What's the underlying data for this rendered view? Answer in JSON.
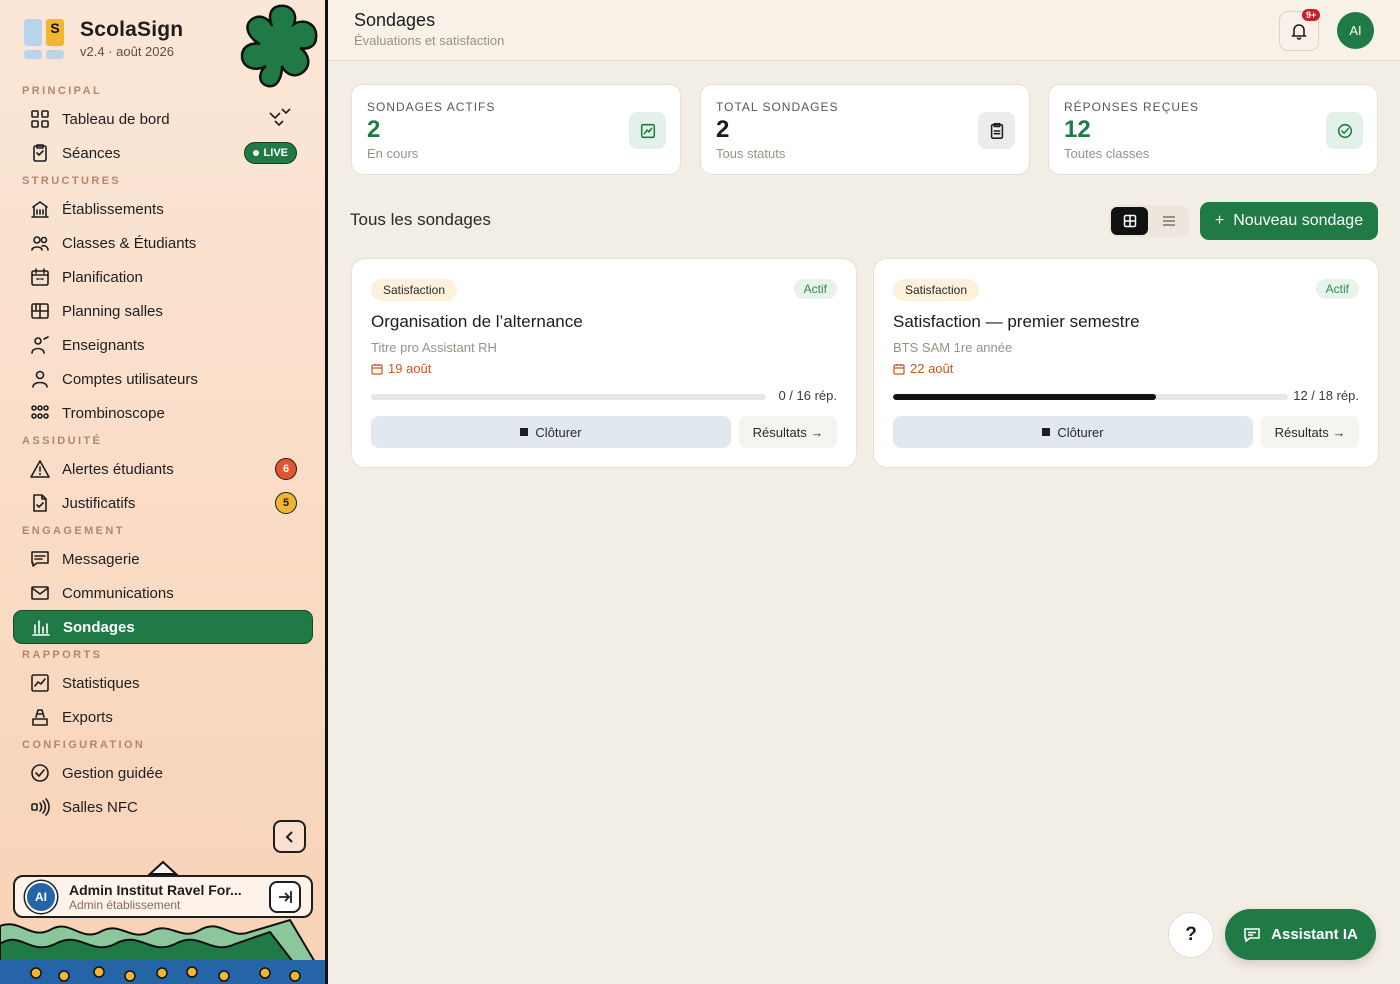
{
  "brand": {
    "name": "ScolaSign",
    "version": "v2.4 · août 2026",
    "logo_letter": "S"
  },
  "sidebar": {
    "sections": [
      {
        "label": "PRINCIPAL",
        "items": [
          {
            "label": "Tableau de bord",
            "icon": "dashboard-icon"
          },
          {
            "label": "Séances",
            "icon": "clipboard-icon",
            "live": "LIVE"
          }
        ]
      },
      {
        "label": "STRUCTURES",
        "items": [
          {
            "label": "Établissements",
            "icon": "building-icon"
          },
          {
            "label": "Classes & Étudiants",
            "icon": "users-icon"
          },
          {
            "label": "Planification",
            "icon": "calendar-icon"
          },
          {
            "label": "Planning salles",
            "icon": "grid-icon"
          },
          {
            "label": "Enseignants",
            "icon": "teacher-icon"
          },
          {
            "label": "Comptes utilisateurs",
            "icon": "user-icon"
          },
          {
            "label": "Trombinoscope",
            "icon": "faces-icon"
          }
        ]
      },
      {
        "label": "ASSIDUITÉ",
        "items": [
          {
            "label": "Alertes étudiants",
            "icon": "warning-icon",
            "badge": "6"
          },
          {
            "label": "Justificatifs",
            "icon": "file-check-icon",
            "badge": "5"
          }
        ]
      },
      {
        "label": "ENGAGEMENT",
        "items": [
          {
            "label": "Messagerie",
            "icon": "message-icon"
          },
          {
            "label": "Communications",
            "icon": "mail-icon"
          },
          {
            "label": "Sondages",
            "icon": "poll-icon"
          }
        ]
      },
      {
        "label": "RAPPORTS",
        "items": [
          {
            "label": "Statistiques",
            "icon": "chart-icon"
          },
          {
            "label": "Exports",
            "icon": "export-icon"
          }
        ]
      },
      {
        "label": "CONFIGURATION",
        "items": [
          {
            "label": "Gestion guidée",
            "icon": "check-circle-icon"
          },
          {
            "label": "Salles NFC",
            "icon": "nfc-icon"
          }
        ]
      }
    ],
    "user": {
      "initials": "AI",
      "name": "Admin Institut Ravel For...",
      "role": "Admin établissement"
    }
  },
  "header": {
    "title": "Sondages",
    "subtitle": "Évaluations et satisfaction",
    "notif_count": "9+",
    "avatar": "AI"
  },
  "stats": [
    {
      "title": "SONDAGES ACTIFS",
      "value": "2",
      "sub": "En cours",
      "value_color": "#1f7a45",
      "icon_bg": "#e4f1ea"
    },
    {
      "title": "TOTAL SONDAGES",
      "value": "2",
      "sub": "Tous statuts",
      "value_color": "#1c1c1c",
      "icon_bg": "#ececec"
    },
    {
      "title": "RÉPONSES REÇUES",
      "value": "12",
      "sub": "Toutes classes",
      "value_color": "#1f7a45",
      "icon_bg": "#e4f1ea"
    }
  ],
  "list": {
    "title": "Tous les sondages",
    "new_button": "Nouveau sondage",
    "new_plus": "+"
  },
  "surveys": [
    {
      "category": "Satisfaction",
      "status": "Actif",
      "title": "Organisation de l’alternance",
      "class": "Titre pro Assistant RH",
      "date": "19 août",
      "responses": "0 / 16 rép.",
      "progress": 0.0,
      "close_label": "Clôturer",
      "results_label": "Résultats →"
    },
    {
      "category": "Satisfaction",
      "status": "Actif",
      "title": "Satisfaction — premier semestre",
      "class": "BTS SAM 1re année",
      "date": "22 août",
      "responses": "12 / 18 rép.",
      "progress": 0.667,
      "close_label": "Clôturer",
      "results_label": "Résultats →"
    }
  ],
  "fab": {
    "help": "?",
    "assistant": "Assistant IA"
  }
}
